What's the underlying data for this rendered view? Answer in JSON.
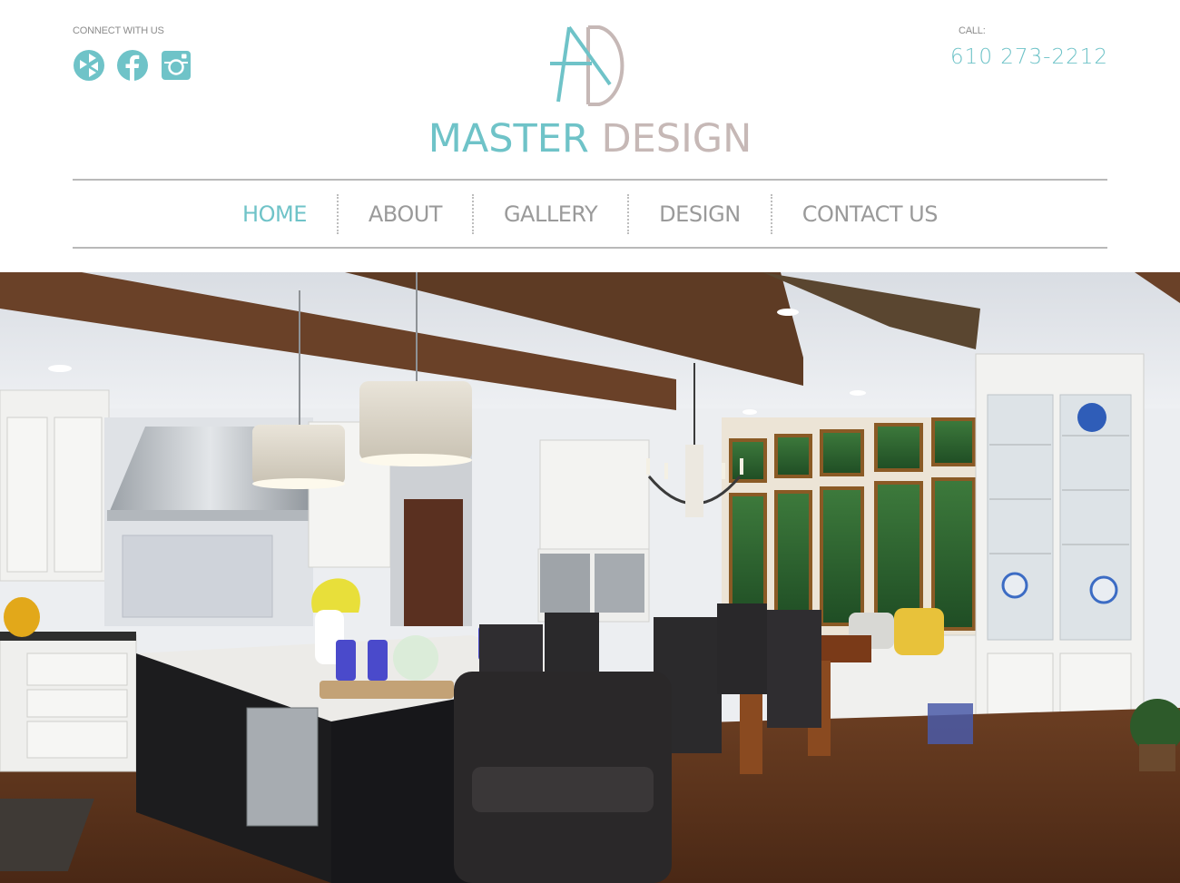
{
  "header": {
    "connect_label": "CONNECT WITH US",
    "call_label": "CALL:",
    "phone": "610 273-2212",
    "social": [
      {
        "name": "houzz",
        "icon": "houzz-icon"
      },
      {
        "name": "facebook",
        "icon": "facebook-icon"
      },
      {
        "name": "instagram",
        "icon": "instagram-icon"
      }
    ]
  },
  "logo": {
    "word1": "MASTER",
    "word2": "DESIGN",
    "monogram": "AD"
  },
  "nav": {
    "items": [
      {
        "label": "HOME",
        "active": true
      },
      {
        "label": "ABOUT",
        "active": false
      },
      {
        "label": "GALLERY",
        "active": false
      },
      {
        "label": "DESIGN",
        "active": false
      },
      {
        "label": "CONTACT US",
        "active": false
      }
    ]
  },
  "colors": {
    "accent": "#6fc3c8",
    "logo_secondary": "#c6b8b6",
    "nav_text": "#9a9a9a",
    "rule": "#b9b9b9"
  },
  "hero": {
    "image": "kitchen-photo"
  }
}
